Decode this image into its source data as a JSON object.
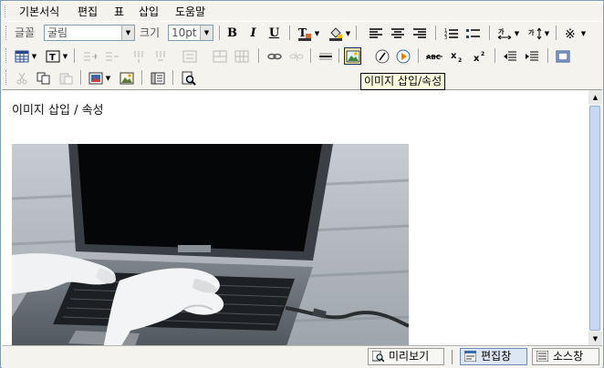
{
  "menu": [
    "기본서식",
    "편집",
    "표",
    "삽입",
    "도움말"
  ],
  "toolbar": {
    "font_label": "글꼴",
    "font_value": "굴림",
    "size_label": "크기",
    "size_value": "10pt",
    "bold": "B",
    "italic": "I",
    "underline": "U"
  },
  "tooltip": "이미지 삽입/속성",
  "editor": {
    "text": "이미지 삽입 / 속성"
  },
  "bottom": {
    "preview": "미리보기",
    "edit": "편집창",
    "source": "소스창"
  }
}
